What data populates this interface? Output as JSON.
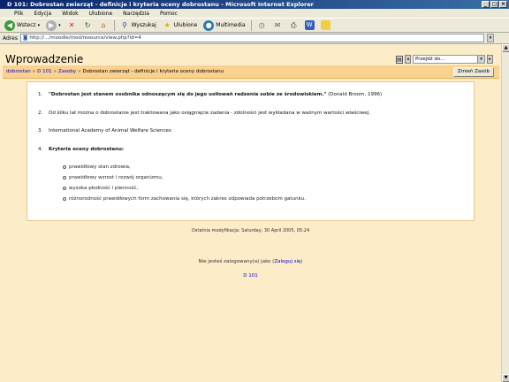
{
  "window": {
    "title": "D 101: Dobrostan zwierząt - definicje i kryteria oceny dobrostanu - Microsoft Internet Explorer",
    "controls": [
      "_",
      "□",
      "×"
    ]
  },
  "menu": [
    "Plik",
    "Edycja",
    "Widok",
    "Ulubione",
    "Narzędzia",
    "Pomoc"
  ],
  "toolbar": {
    "back_label": "Wstecz",
    "search_label": "Wyszukaj",
    "favorites_label": "Ulubione",
    "media_label": "Multimedia"
  },
  "address": {
    "label": "Adres",
    "value": "http://.../moodle/mod/resource/view.php?id=4"
  },
  "page": {
    "title": "Wprowadzenie",
    "jump_label": "Przejdź do...",
    "breadcrumbs": [
      "dobrostan",
      "D 101",
      "Zasoby",
      "Dobrostan zwierząt - definicje i kryteria oceny dobrostanu"
    ],
    "edit_button": "Zmień Zasób",
    "items": [
      {
        "num": "1.",
        "text_bold": "\"Dobrostan jest stanem osobnika odnoszącym się do jego usiłowań radzenia sobie ze środowiskiem.\"",
        "text": " (Donald Broom, 1996)"
      },
      {
        "num": "2.",
        "text_bold": "",
        "text": "Od kilku lat można o dobrostanie jest traktowana jako osiągnięcie zadania - zdolności jest wykładana w ważnym wartości właściwej."
      },
      {
        "num": "3.",
        "text_bold": "",
        "text": "International Academy of Animal Welfare Sciences"
      },
      {
        "num": "4.",
        "text_bold": "Kryteria oceny dobrostanu:",
        "text": ""
      }
    ],
    "criteria": [
      "prawidłowy stan zdrowia,",
      "prawidłowy wzrost i rozwój organizmu,",
      "wysoka płodność i plenność,",
      "różnorodność prawidłowych form zachowania się, których zakres odpowiada potrzebom gatunku."
    ],
    "modified": "Ostatnia modyfikacja: Saturday, 30 April 2005, 05:24",
    "login_text": "Nie jesteś zalogowany(a) jako",
    "login_link": "Zaloguj się",
    "home_link": "D 101"
  }
}
